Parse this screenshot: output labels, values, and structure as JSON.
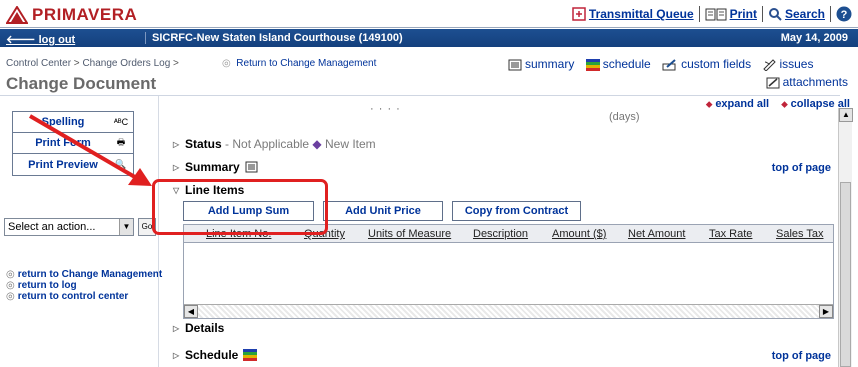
{
  "header": {
    "brand": "PRIMAVERA",
    "links": [
      {
        "label": "Transmittal Queue",
        "icon": "transmittal-icon"
      },
      {
        "label": "Print",
        "icon": "print-icon"
      },
      {
        "label": "Search",
        "icon": "search-icon"
      }
    ],
    "help_icon": "help-icon"
  },
  "bar": {
    "logout": "log out",
    "project": "SICRFC-New Staten Island Courthouse (149100)",
    "date": "May 14, 2009"
  },
  "breadcrumb": {
    "items": [
      "Control Center",
      "Change Orders Log"
    ],
    "separator": " > ",
    "return": "Return to Change Management"
  },
  "page": {
    "title": "Change Document"
  },
  "views": {
    "summary": "summary",
    "schedule": "schedule",
    "custom_fields": "custom fields",
    "issues": "issues",
    "attachments": "attachments"
  },
  "expand": {
    "expand_all": "expand all",
    "collapse_all": "collapse all"
  },
  "tools": [
    {
      "label": "Spelling",
      "icon": "spellcheck-icon",
      "glyph": "ᴬᴮC"
    },
    {
      "label": "Print Form",
      "icon": "printer-icon",
      "glyph": "🖶"
    },
    {
      "label": "Print Preview",
      "icon": "preview-icon",
      "glyph": "🔍"
    }
  ],
  "actions": {
    "selected": "Select an action...",
    "go": "Go"
  },
  "left_links": {
    "return_cm": "return to Change Management",
    "return_log": "return to log",
    "return_cc": "return to control center"
  },
  "partial_text": {
    "days": "(days)",
    "dots": "· · · ·"
  },
  "sections": {
    "status": {
      "label": "Status",
      "value": "Not Applicable",
      "extra": "New Item"
    },
    "summary": {
      "label": "Summary"
    },
    "line_items": {
      "label": "Line Items"
    },
    "details": {
      "label": "Details"
    },
    "schedule": {
      "label": "Schedule"
    },
    "top_of_page": "top of page"
  },
  "line_items": {
    "buttons": [
      "Add Lump Sum",
      "Add Unit Price",
      "Copy from Contract"
    ],
    "columns": [
      "Line Item No.",
      "Quantity",
      "Units of Measure",
      "Description",
      "Amount ($)",
      "Net Amount",
      "Tax Rate",
      "Sales Tax"
    ]
  },
  "colors": {
    "brand": "#b21f24",
    "bar": "#1d4f91",
    "link": "#00339a",
    "callout": "#e02020"
  }
}
